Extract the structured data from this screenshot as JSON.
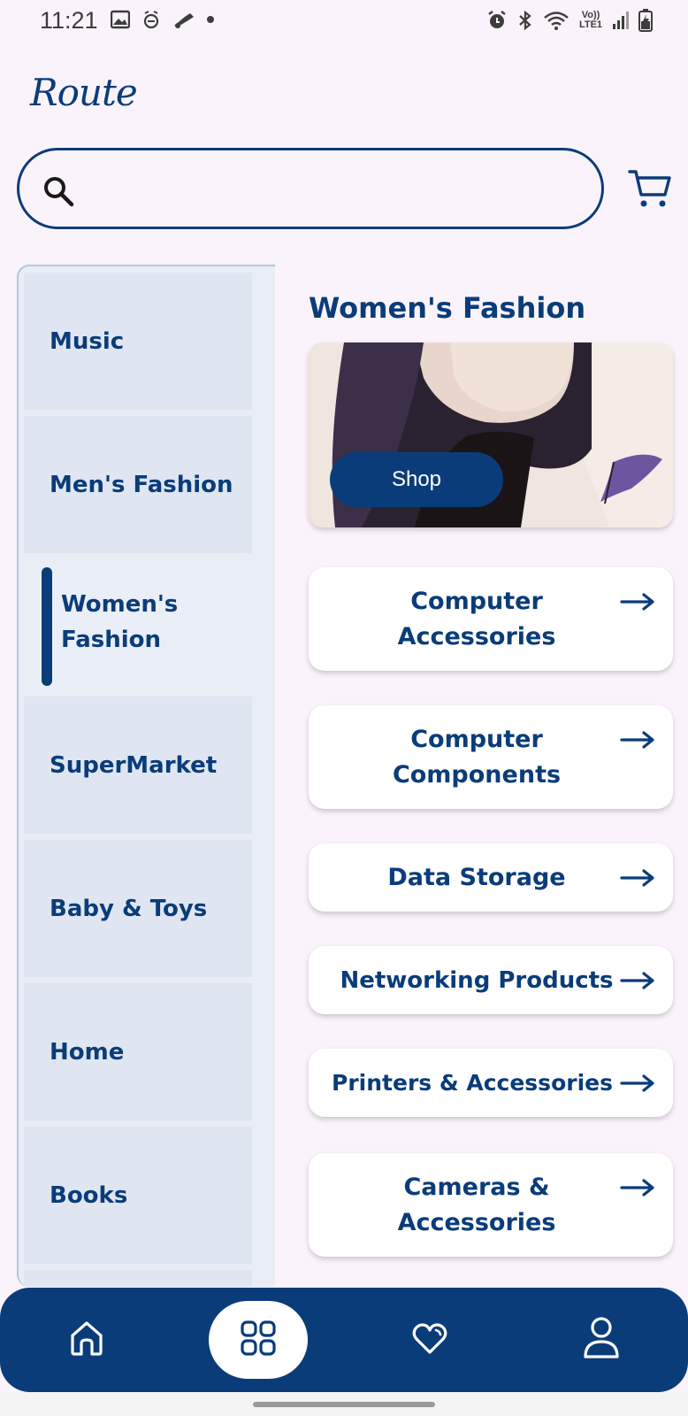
{
  "status_bar": {
    "time": "11:21",
    "left_icons": [
      "image-icon",
      "alarm-snooze-icon",
      "scooter-icon",
      "dot-icon"
    ],
    "right_icons": [
      "alarm-icon",
      "bluetooth-icon",
      "wifi-icon",
      "volte-icon",
      "signal-icon",
      "battery-icon"
    ],
    "volte_label": "Vo)) LTE1"
  },
  "header": {
    "logo": "Route"
  },
  "search": {
    "value": "",
    "placeholder": ""
  },
  "sidebar": {
    "items": [
      {
        "label": "Music",
        "active": false
      },
      {
        "label": "Men's Fashion",
        "active": false
      },
      {
        "label": "Women's Fashion",
        "active": true
      },
      {
        "label": "SuperMarket",
        "active": false
      },
      {
        "label": "Baby & Toys",
        "active": false
      },
      {
        "label": "Home",
        "active": false
      },
      {
        "label": "Books",
        "active": false
      }
    ]
  },
  "main": {
    "title": "Women's Fashion",
    "banner": {
      "button_label": "Shop"
    },
    "subcategories": [
      {
        "label": "Computer Accessories"
      },
      {
        "label": "Computer Components"
      },
      {
        "label": "Data Storage"
      },
      {
        "label": "Networking Products"
      },
      {
        "label": "Printers & Accessories"
      },
      {
        "label": "Cameras & Accessories"
      }
    ]
  },
  "bottom_nav": {
    "items": [
      {
        "icon": "home-icon",
        "active": false
      },
      {
        "icon": "categories-grid-icon",
        "active": true
      },
      {
        "icon": "heart-icon",
        "active": false
      },
      {
        "icon": "profile-icon",
        "active": false
      }
    ]
  },
  "colors": {
    "primary": "#0a3c7a",
    "background": "#fbf3fb",
    "sidebar_bg": "#dfe6f1",
    "card_bg": "#ffffff"
  }
}
